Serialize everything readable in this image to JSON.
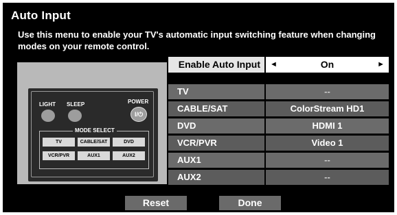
{
  "window": {
    "title": "Auto Input",
    "description": "Use this menu to enable your TV's automatic input switching feature when changing modes on your remote control."
  },
  "remote": {
    "light_label": "LIGHT",
    "sleep_label": "SLEEP",
    "power_label": "POWER",
    "power_symbol": "I/⏻",
    "mode_select_label": "MODE SELECT",
    "mode_buttons": [
      "TV",
      "CABLE/SAT",
      "DVD",
      "VCR/PVR",
      "AUX1",
      "AUX2"
    ]
  },
  "enable_auto_input": {
    "label": "Enable Auto Input",
    "value": "On",
    "left_arrow": "◄",
    "right_arrow": "►"
  },
  "inputs": [
    {
      "label": "TV",
      "value": "--"
    },
    {
      "label": "CABLE/SAT",
      "value": "ColorStream HD1"
    },
    {
      "label": "DVD",
      "value": "HDMI 1"
    },
    {
      "label": "VCR/PVR",
      "value": "Video 1"
    },
    {
      "label": "AUX1",
      "value": "--"
    },
    {
      "label": "AUX2",
      "value": "--"
    }
  ],
  "buttons": {
    "reset": "Reset",
    "done": "Done"
  }
}
